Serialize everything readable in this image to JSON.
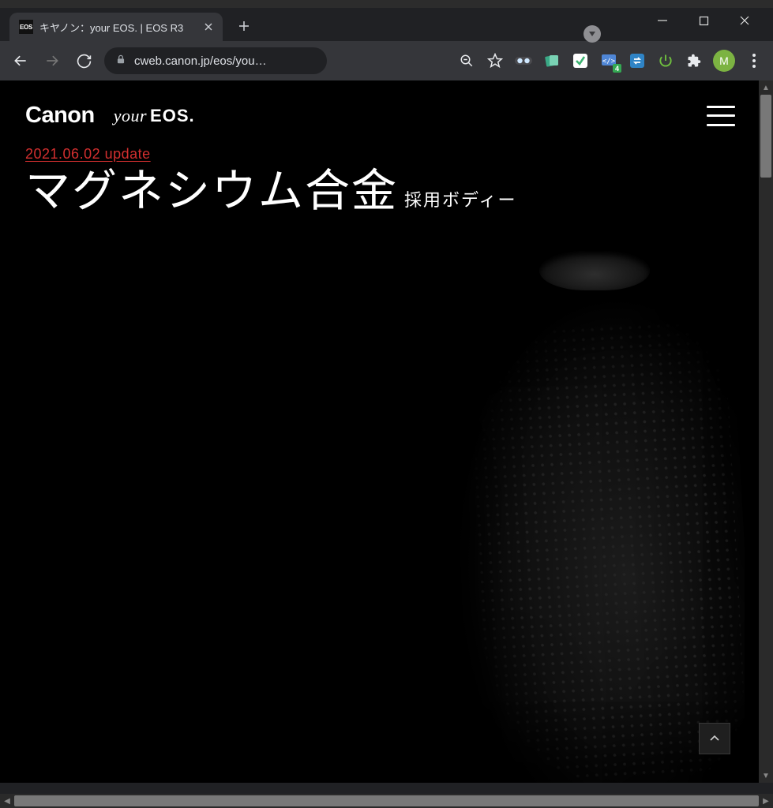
{
  "browser": {
    "tab": {
      "favicon_text": "EOS",
      "title": "キヤノン：your EOS. | EOS R3"
    },
    "address": "cweb.canon.jp/eos/you…",
    "devtools_badge": "4",
    "avatar_letter": "M"
  },
  "page": {
    "brand_main": "Canon",
    "brand_sub_your": "your",
    "brand_sub_eos": "EOS.",
    "update_line": "2021.06.02 update",
    "headline_main": "マグネシウム合金",
    "headline_sub": "採用ボディー"
  }
}
